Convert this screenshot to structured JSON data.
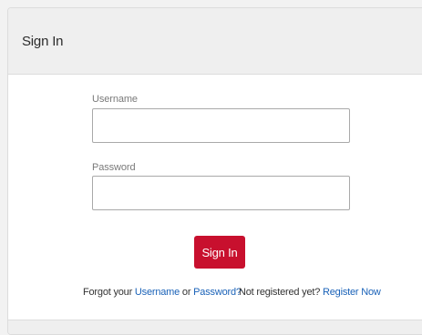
{
  "panel": {
    "title": "Sign In"
  },
  "form": {
    "username_label": "Username",
    "username_value": "",
    "password_label": "Password",
    "password_value": "",
    "submit_label": "Sign In"
  },
  "links": {
    "forgot_prefix": "Forgot your",
    "username_link": "Username",
    "or_text": "or",
    "password_link": "Password?",
    "not_registered": "Not registered yet?",
    "register_link": "Register Now"
  },
  "colors": {
    "accent": "#c8102e",
    "link": "#1a62b8"
  }
}
